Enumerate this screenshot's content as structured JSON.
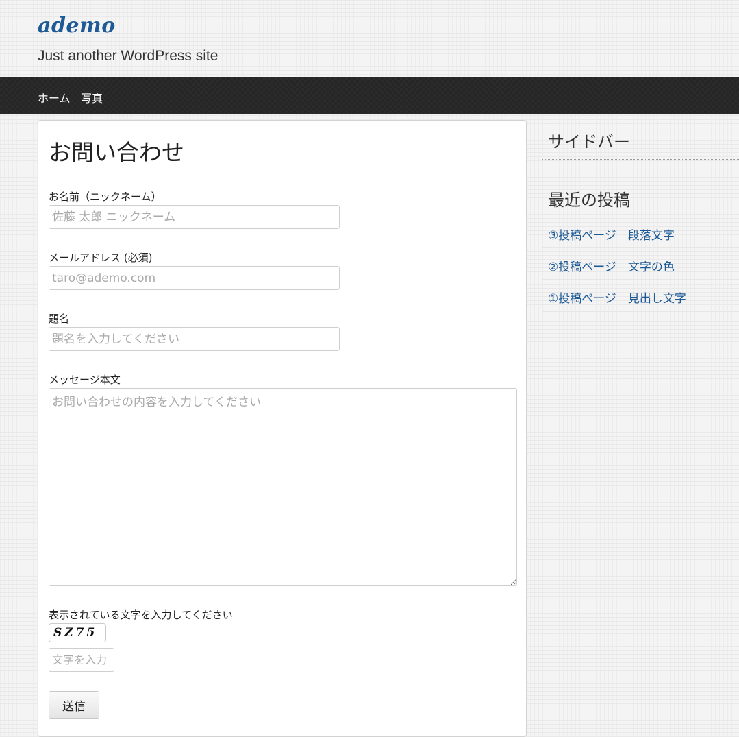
{
  "site": {
    "title": "ademo",
    "description": "Just another WordPress site"
  },
  "nav": {
    "items": [
      "ホーム",
      "写真"
    ]
  },
  "page": {
    "title": "お問い合わせ"
  },
  "form": {
    "name_label": "お名前（ニックネーム）",
    "name_placeholder": "佐藤 太郎 ニックネーム",
    "email_label": "メールアドレス (必須)",
    "email_placeholder": "taro@ademo.com",
    "subject_label": "題名",
    "subject_placeholder": "題名を入力してください",
    "message_label": "メッセージ本文",
    "message_placeholder": "お問い合わせの内容を入力してください",
    "captcha_label": "表示されている文字を入力してください",
    "captcha_text": "SZ75",
    "captcha_placeholder": "文字を入力",
    "submit_label": "送信"
  },
  "sidebar": {
    "title": "サイドバー",
    "recent_title": "最近の投稿",
    "recent_posts": [
      "③投稿ページ　段落文字",
      "②投稿ページ　文字の色",
      "①投稿ページ　見出し文字"
    ]
  },
  "colors": {
    "link": "#1e5a96",
    "nav_bg": "#2b2b2b"
  }
}
